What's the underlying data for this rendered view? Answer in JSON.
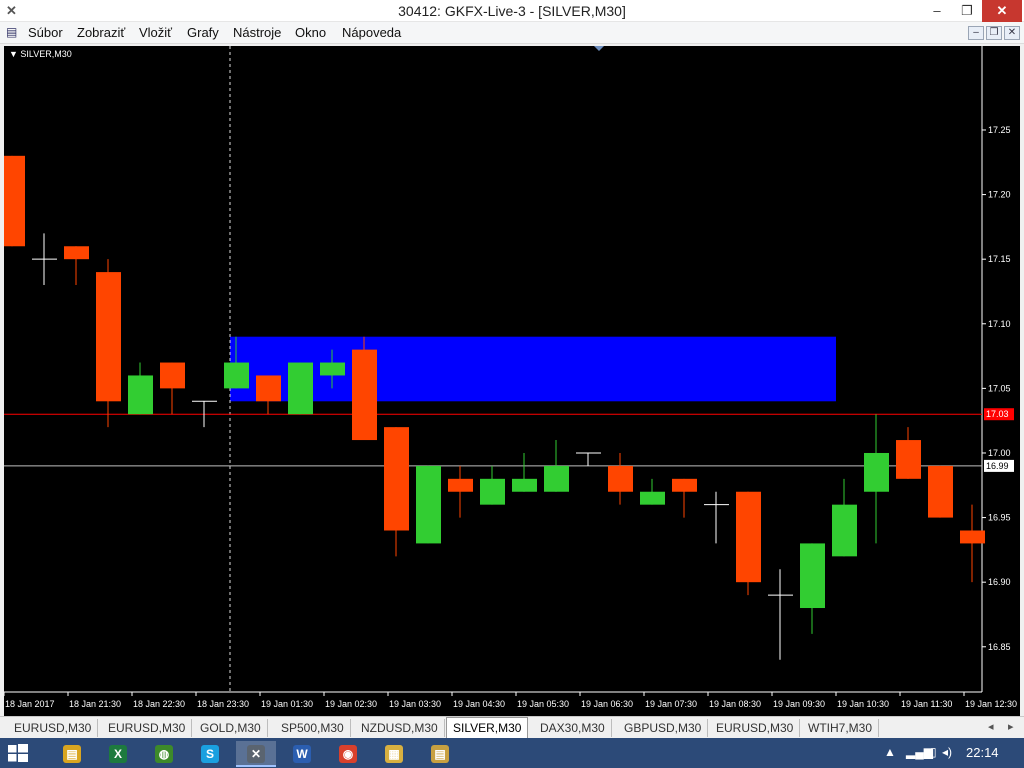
{
  "window": {
    "title": "30412: GKFX-Live-3 - [SILVER,M30]",
    "app_icon": "x-icon",
    "minimize": "–",
    "restore": "❐",
    "close": "✕"
  },
  "menu": [
    "Súbor",
    "Zobraziť",
    "Vložiť",
    "Grafy",
    "Nástroje",
    "Okno",
    "Nápoveda"
  ],
  "mdi": {
    "minimize": "–",
    "restore": "❐",
    "close": "✕"
  },
  "chart_label": "▼ SILVER,M30",
  "colors": {
    "bull": "#32cd32",
    "bear": "#ff4500",
    "doji": "#ffffff",
    "zone": "#0000ff",
    "hline": "#ff0000",
    "bid_line": "#c0c0c0"
  },
  "chart_data": {
    "type": "candlestick",
    "symbol": "SILVER,M30",
    "ylim": [
      16.815,
      17.315
    ],
    "y_ticks": [
      "17.25",
      "17.20",
      "17.15",
      "17.10",
      "17.05",
      "17.00",
      "16.95",
      "16.90",
      "16.85"
    ],
    "y_tick_values": [
      17.25,
      17.2,
      17.15,
      17.1,
      17.05,
      17.0,
      16.95,
      16.9,
      16.85
    ],
    "x_labels": [
      "18 Jan 2017",
      "18 Jan 21:30",
      "18 Jan 22:30",
      "18 Jan 23:30",
      "19 Jan 01:30",
      "19 Jan 02:30",
      "19 Jan 03:30",
      "19 Jan 04:30",
      "19 Jan 05:30",
      "19 Jan 06:30",
      "19 Jan 07:30",
      "19 Jan 08:30",
      "19 Jan 09:30",
      "19 Jan 10:30",
      "19 Jan 11:30",
      "19 Jan 12:30"
    ],
    "candles": [
      {
        "o": 17.23,
        "h": 17.23,
        "l": 17.16,
        "c": 17.16
      },
      {
        "o": 17.15,
        "h": 17.17,
        "l": 17.13,
        "c": 17.15
      },
      {
        "o": 17.16,
        "h": 17.16,
        "l": 17.13,
        "c": 17.15
      },
      {
        "o": 17.14,
        "h": 17.15,
        "l": 17.02,
        "c": 17.04
      },
      {
        "o": 17.03,
        "h": 17.07,
        "l": 17.03,
        "c": 17.06
      },
      {
        "o": 17.07,
        "h": 17.07,
        "l": 17.03,
        "c": 17.05
      },
      {
        "o": 17.04,
        "h": 17.04,
        "l": 17.02,
        "c": 17.04
      },
      {
        "o": 17.05,
        "h": 17.09,
        "l": 17.05,
        "c": 17.07
      },
      {
        "o": 17.06,
        "h": 17.06,
        "l": 17.03,
        "c": 17.04
      },
      {
        "o": 17.03,
        "h": 17.07,
        "l": 17.03,
        "c": 17.07
      },
      {
        "o": 17.06,
        "h": 17.08,
        "l": 17.05,
        "c": 17.07
      },
      {
        "o": 17.08,
        "h": 17.09,
        "l": 17.01,
        "c": 17.01
      },
      {
        "o": 17.02,
        "h": 17.02,
        "l": 16.92,
        "c": 16.94
      },
      {
        "o": 16.93,
        "h": 16.99,
        "l": 16.93,
        "c": 16.99
      },
      {
        "o": 16.98,
        "h": 16.99,
        "l": 16.95,
        "c": 16.97
      },
      {
        "o": 16.96,
        "h": 16.99,
        "l": 16.96,
        "c": 16.98
      },
      {
        "o": 16.97,
        "h": 17.0,
        "l": 16.97,
        "c": 16.98
      },
      {
        "o": 16.97,
        "h": 17.01,
        "l": 16.97,
        "c": 16.99
      },
      {
        "o": 17.0,
        "h": 17.0,
        "l": 16.99,
        "c": 17.0
      },
      {
        "o": 16.99,
        "h": 17.0,
        "l": 16.96,
        "c": 16.97
      },
      {
        "o": 16.96,
        "h": 16.98,
        "l": 16.96,
        "c": 16.97
      },
      {
        "o": 16.98,
        "h": 16.98,
        "l": 16.95,
        "c": 16.97
      },
      {
        "o": 16.96,
        "h": 16.97,
        "l": 16.93,
        "c": 16.96
      },
      {
        "o": 16.97,
        "h": 16.97,
        "l": 16.89,
        "c": 16.9
      },
      {
        "o": 16.89,
        "h": 16.91,
        "l": 16.84,
        "c": 16.89
      },
      {
        "o": 16.88,
        "h": 16.93,
        "l": 16.86,
        "c": 16.93
      },
      {
        "o": 16.92,
        "h": 16.98,
        "l": 16.92,
        "c": 16.96
      },
      {
        "o": 16.97,
        "h": 17.03,
        "l": 16.93,
        "c": 17.0
      },
      {
        "o": 17.01,
        "h": 17.02,
        "l": 16.98,
        "c": 16.98
      },
      {
        "o": 16.99,
        "h": 16.99,
        "l": 16.95,
        "c": 16.95
      },
      {
        "o": 16.94,
        "h": 16.96,
        "l": 16.9,
        "c": 16.93
      }
    ],
    "zone": {
      "top": 17.09,
      "bottom": 17.04
    },
    "horizontal_line": 17.03,
    "horizontal_line_label": "17.03",
    "bid_line": 16.99,
    "bid_label": "16.99"
  },
  "tabs": [
    "EURUSD,M30",
    "EURUSD,M30",
    "GOLD,M30",
    "SP500,M30",
    "NZDUSD,M30",
    "SILVER,M30",
    "DAX30,M30",
    "GBPUSD,M30",
    "EURUSD,M30",
    "WTIH7,M30"
  ],
  "active_tab": 5,
  "taskbar": {
    "apps": [
      {
        "icon": "folder-icon",
        "glyph": "▤",
        "color": "#d9a520"
      },
      {
        "icon": "excel-icon",
        "glyph": "X",
        "color": "#1d7a3e"
      },
      {
        "icon": "globe-icon",
        "glyph": "◍",
        "color": "#3d8a2a"
      },
      {
        "icon": "skype-icon",
        "glyph": "S",
        "color": "#1aa0e0"
      },
      {
        "icon": "metatrader-icon",
        "glyph": "✕",
        "color": "#5a6470"
      },
      {
        "icon": "word-icon",
        "glyph": "W",
        "color": "#2b5eb0"
      },
      {
        "icon": "chrome-icon",
        "glyph": "◉",
        "color": "#d8402c"
      },
      {
        "icon": "explorer-icon",
        "glyph": "▦",
        "color": "#d8b040"
      },
      {
        "icon": "app-icon",
        "glyph": "▤",
        "color": "#c8a040"
      }
    ],
    "clock": "22:14"
  }
}
